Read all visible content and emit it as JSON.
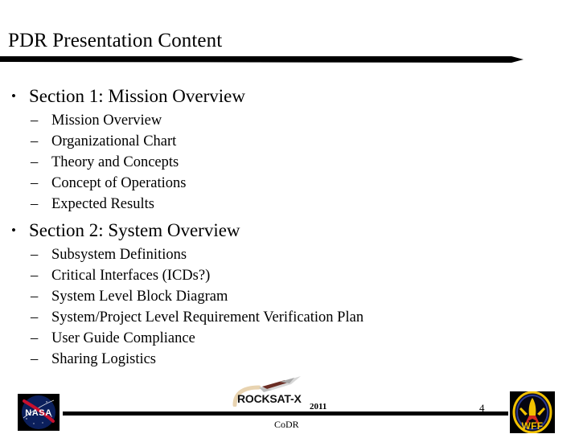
{
  "slide": {
    "title": "PDR Presentation Content",
    "background_color": "#ffffff",
    "text_color": "#000000",
    "rule_color": "#000000"
  },
  "content": {
    "sections": [
      {
        "bullet_mark": "•",
        "label": "Section 1: Mission Overview",
        "sub_mark": "–",
        "items": [
          "Mission Overview",
          "Organizational Chart",
          "Theory and Concepts",
          "Concept of Operations",
          "Expected Results"
        ]
      },
      {
        "bullet_mark": "•",
        "label": "Section 2: System Overview",
        "sub_mark": "–",
        "items": [
          "Subsystem Definitions",
          "Critical Interfaces (ICDs?)",
          "System Level Block Diagram",
          "System/Project Level Requirement Verification Plan",
          "User Guide Compliance",
          "Sharing Logistics"
        ]
      }
    ]
  },
  "footer": {
    "nasa_logo_text": "NASA",
    "program_logo_text": "ROCKSAT-X",
    "program_year": "2011",
    "review_name": "CoDR",
    "page_number": "4",
    "wff_logo_text": "WFF",
    "colors": {
      "nasa_blue": "#0b1f5c",
      "nasa_red": "#c8102e",
      "wff_gold": "#f2c200",
      "wff_red": "#d22b1e",
      "rocket_trail": "#e8d3b0"
    }
  }
}
